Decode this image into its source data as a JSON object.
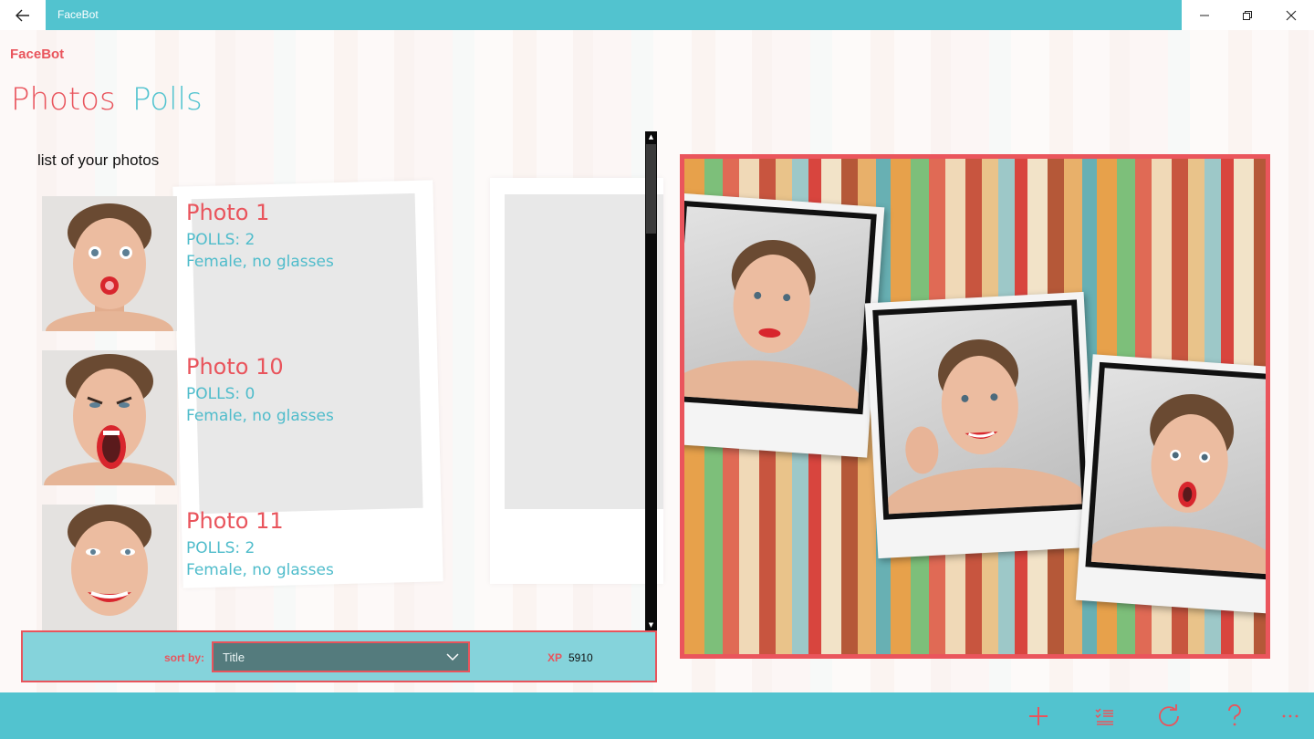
{
  "window": {
    "title": "FaceBot",
    "back_icon": "arrow-left-icon",
    "controls": [
      "minimize-icon",
      "restore-icon",
      "close-icon"
    ]
  },
  "colors": {
    "accent_teal": "#52c3cf",
    "accent_red": "#e9545c",
    "panel_teal": "#85d3db",
    "select_bg": "#547b7d"
  },
  "header": {
    "brand": "FaceBot",
    "tabs": [
      {
        "label": "Photos",
        "active": true
      },
      {
        "label": "Polls",
        "active": false
      }
    ]
  },
  "list": {
    "heading": "list of your photos",
    "items": [
      {
        "title": "Photo 1",
        "polls": "POLLS: 2",
        "description": "Female, no glasses"
      },
      {
        "title": "Photo 10",
        "polls": "POLLS: 0",
        "description": "Female, no glasses"
      },
      {
        "title": "Photo 11",
        "polls": "POLLS: 2",
        "description": "Female, no glasses"
      }
    ]
  },
  "sort": {
    "label": "sort by:",
    "selected": "Title",
    "xp_label": "XP",
    "xp_value": "5910"
  },
  "appbar": {
    "icons": [
      "add-icon",
      "checklist-icon",
      "refresh-icon",
      "help-icon",
      "more-icon"
    ]
  }
}
